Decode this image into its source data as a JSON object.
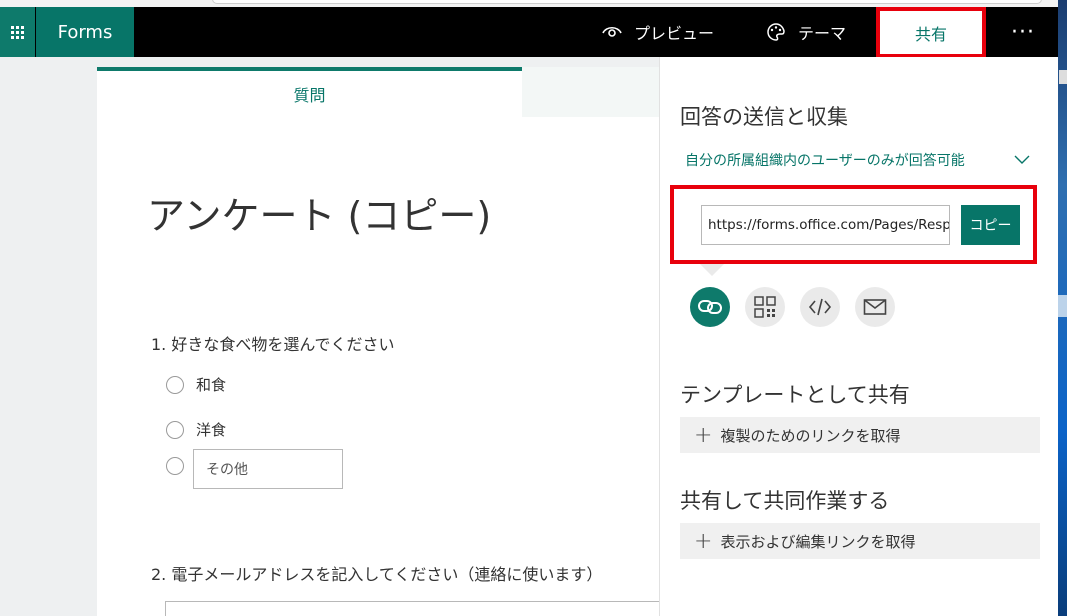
{
  "header": {
    "app_name": "Forms",
    "preview_label": "プレビュー",
    "theme_label": "テーマ",
    "share_label": "共有",
    "more_label": "···"
  },
  "form": {
    "tab_questions": "質問",
    "title": "アンケート (コピー)",
    "questions": [
      {
        "label": "1. 好きな食べ物を選んでください",
        "options": [
          "和食",
          "洋食"
        ],
        "other_placeholder": "その他"
      },
      {
        "label": "2. 電子メールアドレスを記入してください（連絡に使います）"
      }
    ]
  },
  "share_panel": {
    "heading_send": "回答の送信と収集",
    "permission": "自分の所属組織内のユーザーのみが回答可能",
    "url": "https://forms.office.com/Pages/ResponsePage.aspx",
    "copy_label": "コピー",
    "share_icons": [
      "link-icon",
      "qr-code-icon",
      "embed-icon",
      "email-icon"
    ],
    "heading_template": "テンプレートとして共有",
    "template_link_label": "複製のためのリンクを取得",
    "heading_collaborate": "共有して共同作業する",
    "collaborate_link_label": "表示および編集リンクを取得"
  },
  "colors": {
    "brand": "#077568",
    "highlight": "#e8000c"
  }
}
